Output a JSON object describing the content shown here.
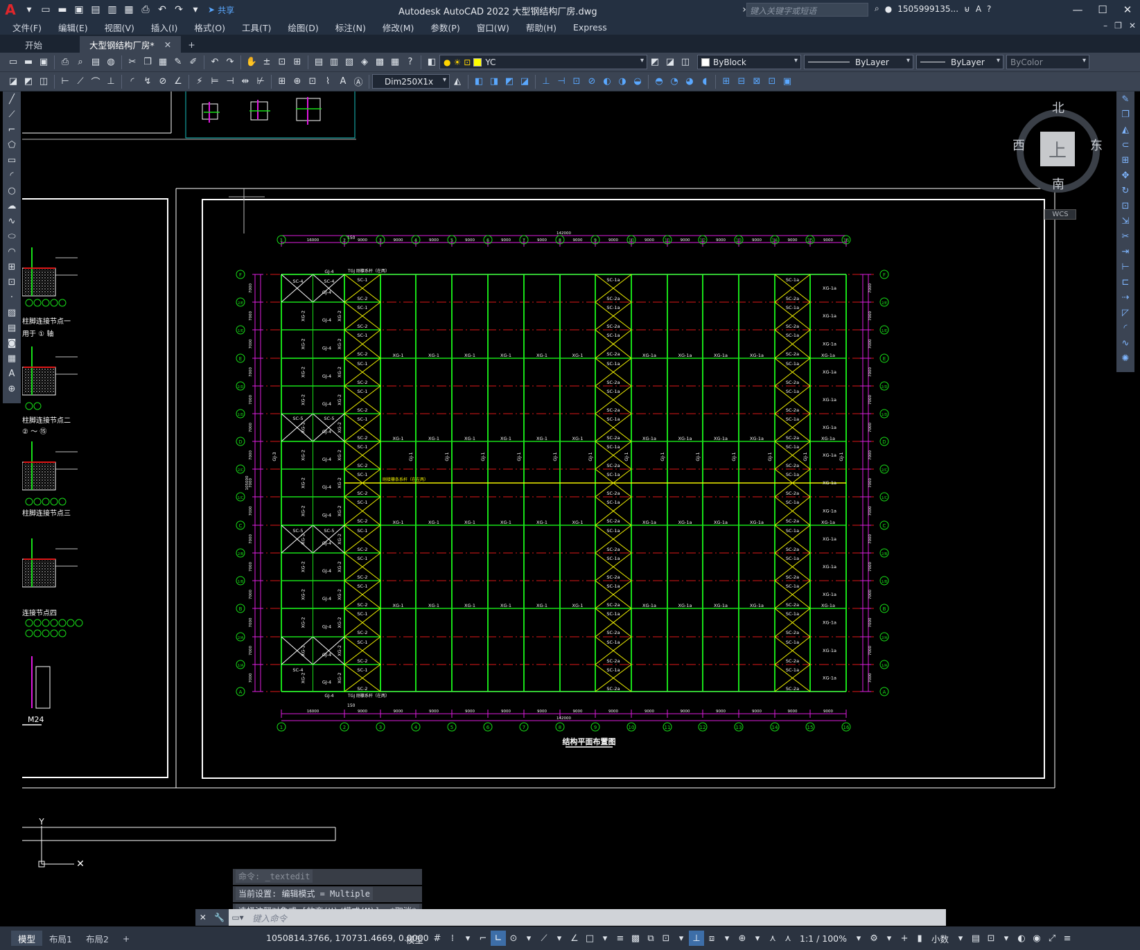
{
  "title_bar": {
    "app_logo": "A",
    "share_label": "共享",
    "document_title": "Autodesk AutoCAD 2022    大型钢结构厂房.dwg",
    "search_placeholder": "键入关键字或短语",
    "user": "1505999135...",
    "icons": [
      "new-icon",
      "open-icon",
      "save-icon",
      "saveas-icon",
      "open-web-icon",
      "save-web-icon",
      "plot-icon",
      "undo-icon",
      "redo-icon",
      "share-icon",
      "search-icon",
      "user-icon",
      "cart-icon",
      "autodesk-icon",
      "help-icon",
      "minimize-icon",
      "maximize-icon",
      "close-icon"
    ]
  },
  "menu": [
    "文件(F)",
    "编辑(E)",
    "视图(V)",
    "插入(I)",
    "格式(O)",
    "工具(T)",
    "绘图(D)",
    "标注(N)",
    "修改(M)",
    "参数(P)",
    "窗口(W)",
    "帮助(H)",
    "Express"
  ],
  "file_tabs": {
    "start": "开始",
    "active": "大型钢结构厂房*"
  },
  "properties": {
    "layer": "YC",
    "color": "ByBlock",
    "linetype": "ByLayer",
    "lineweight": "ByLayer",
    "plotstyle": "ByColor",
    "dimstyle": "Dim250X1x"
  },
  "viewcube": {
    "north": "北",
    "south": "南",
    "east": "东",
    "west": "西",
    "face": "上",
    "wcs": "WCS"
  },
  "drawing": {
    "plan_title": "结构平面布置图",
    "total_dim_top": "142000",
    "total_dim_bottom": "142000",
    "total_dim_side": "105000",
    "axes_cols": [
      "1",
      "2",
      "3",
      "4",
      "5",
      "6",
      "7",
      "8",
      "9",
      "10",
      "11",
      "12",
      "13",
      "14",
      "15",
      "16"
    ],
    "axes_rows": [
      "F",
      "2/E",
      "1/E",
      "E",
      "2/D",
      "1/D",
      "D",
      "2/C",
      "1/C",
      "C",
      "2/B",
      "1/B",
      "B",
      "2/A",
      "1/A",
      "A"
    ],
    "col_spacings": [
      "16000",
      "9000",
      "9000",
      "9000",
      "9000",
      "9000",
      "9000",
      "9000",
      "9000",
      "9000",
      "9000",
      "9000",
      "9000",
      "9000",
      "9000"
    ],
    "row_spacing": "7000",
    "labels": {
      "gj4": "GJ-4",
      "sc1": "SC-1",
      "sc2": "SC-2",
      "sc1a": "SC-1a",
      "sc2a": "SC-2a",
      "sc4": "SC-4",
      "sc5": "SC-5",
      "xg1": "XG-1",
      "xg1a": "XG-1a",
      "xg2": "XG-2",
      "gj1": "GJ-1",
      "gj3": "GJ-3",
      "tie_top": "TGJ 刚檩系杆（在两）",
      "tie_mid": "刚接檩条系杆（在左两）",
      "dim150": "150"
    },
    "left_details": {
      "detail1": "柱脚连接节点一",
      "detail2": "柱脚连接节点二",
      "detail3": "柱脚连接节点三",
      "detail4": "连接节点四",
      "apply1": "用于 ① 轴",
      "apply2": "② ～ ⑮",
      "bolt": "M24"
    }
  },
  "command": {
    "line1": "命令: _textedit",
    "line2": "当前设置: 编辑模式 = Multiple",
    "line3": "选择注释对象或 [放弃(U)/模式(M)]: *取消*",
    "placeholder": "键入命令"
  },
  "layout_tabs": [
    "模型",
    "布局1",
    "布局2"
  ],
  "status": {
    "coords": "1050814.3766, 170731.4669, 0.0000",
    "space": "模型",
    "scale": "1:1 / 100%",
    "units": "小数"
  },
  "colors": {
    "column_line": "#18e018",
    "brace": "#f2f200",
    "beam_red": "#e01818",
    "dim_magenta": "#e01ee0",
    "bubble": "#18e018",
    "frame_white": "#ffffff"
  }
}
